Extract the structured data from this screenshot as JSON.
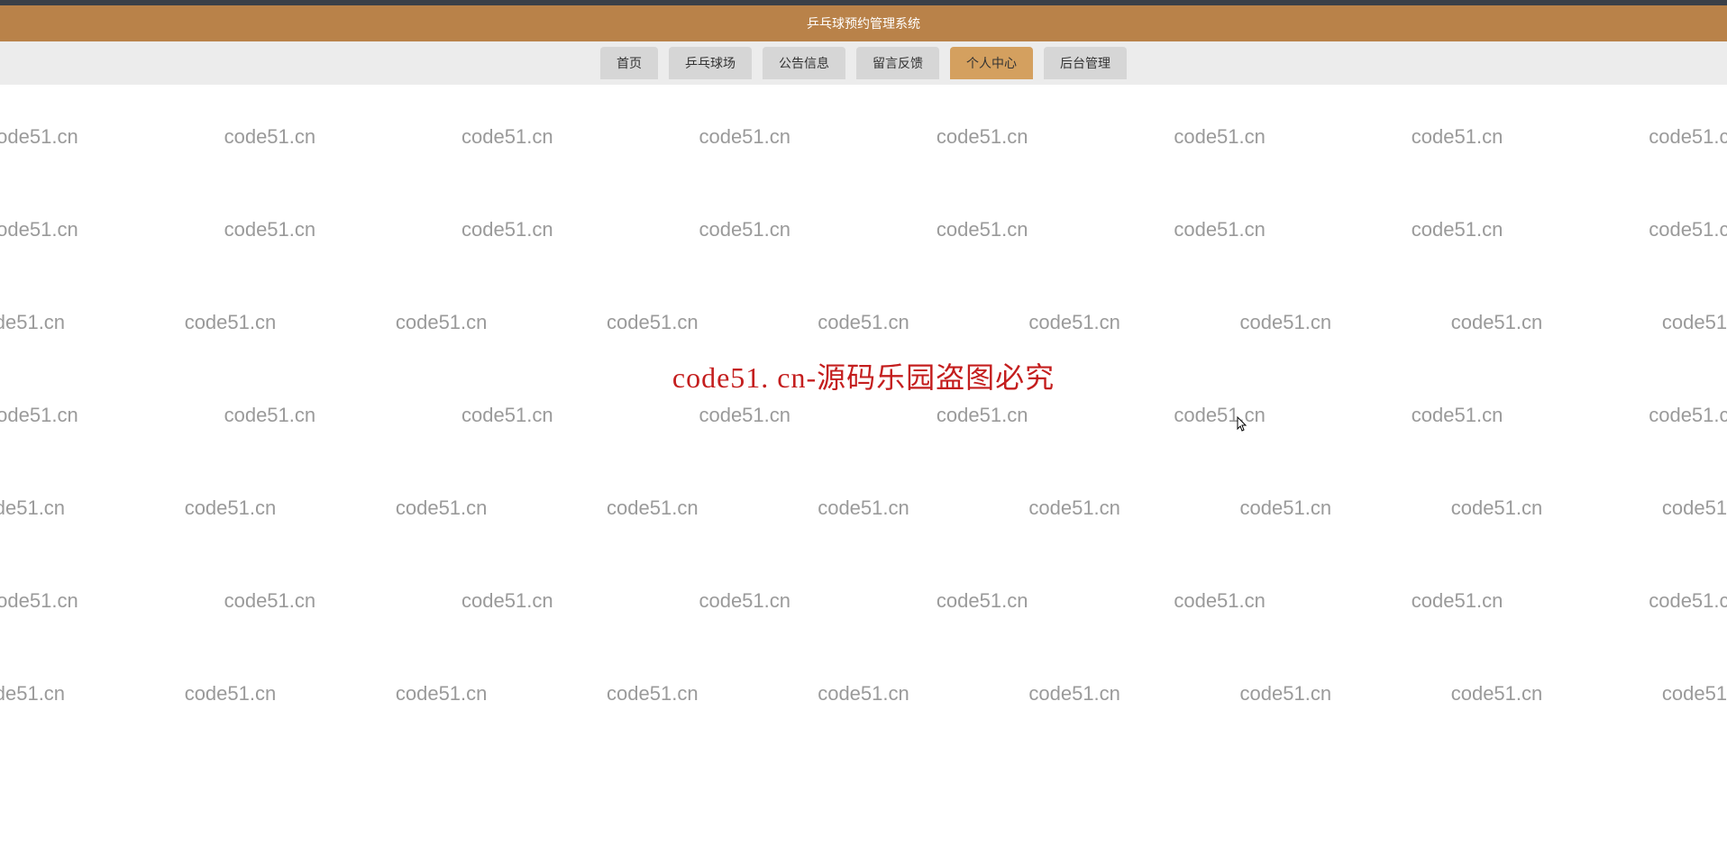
{
  "header": {
    "title": "乒乓球预约管理系统"
  },
  "nav": {
    "items": [
      {
        "label": "首页",
        "active": false
      },
      {
        "label": "乒乓球场",
        "active": false
      },
      {
        "label": "公告信息",
        "active": false
      },
      {
        "label": "留言反馈",
        "active": false
      },
      {
        "label": "个人中心",
        "active": true
      },
      {
        "label": "后台管理",
        "active": false
      }
    ]
  },
  "watermark": {
    "text": "code51.cn"
  },
  "centerNotice": {
    "text": "code51. cn-源码乐园盗图必究"
  }
}
